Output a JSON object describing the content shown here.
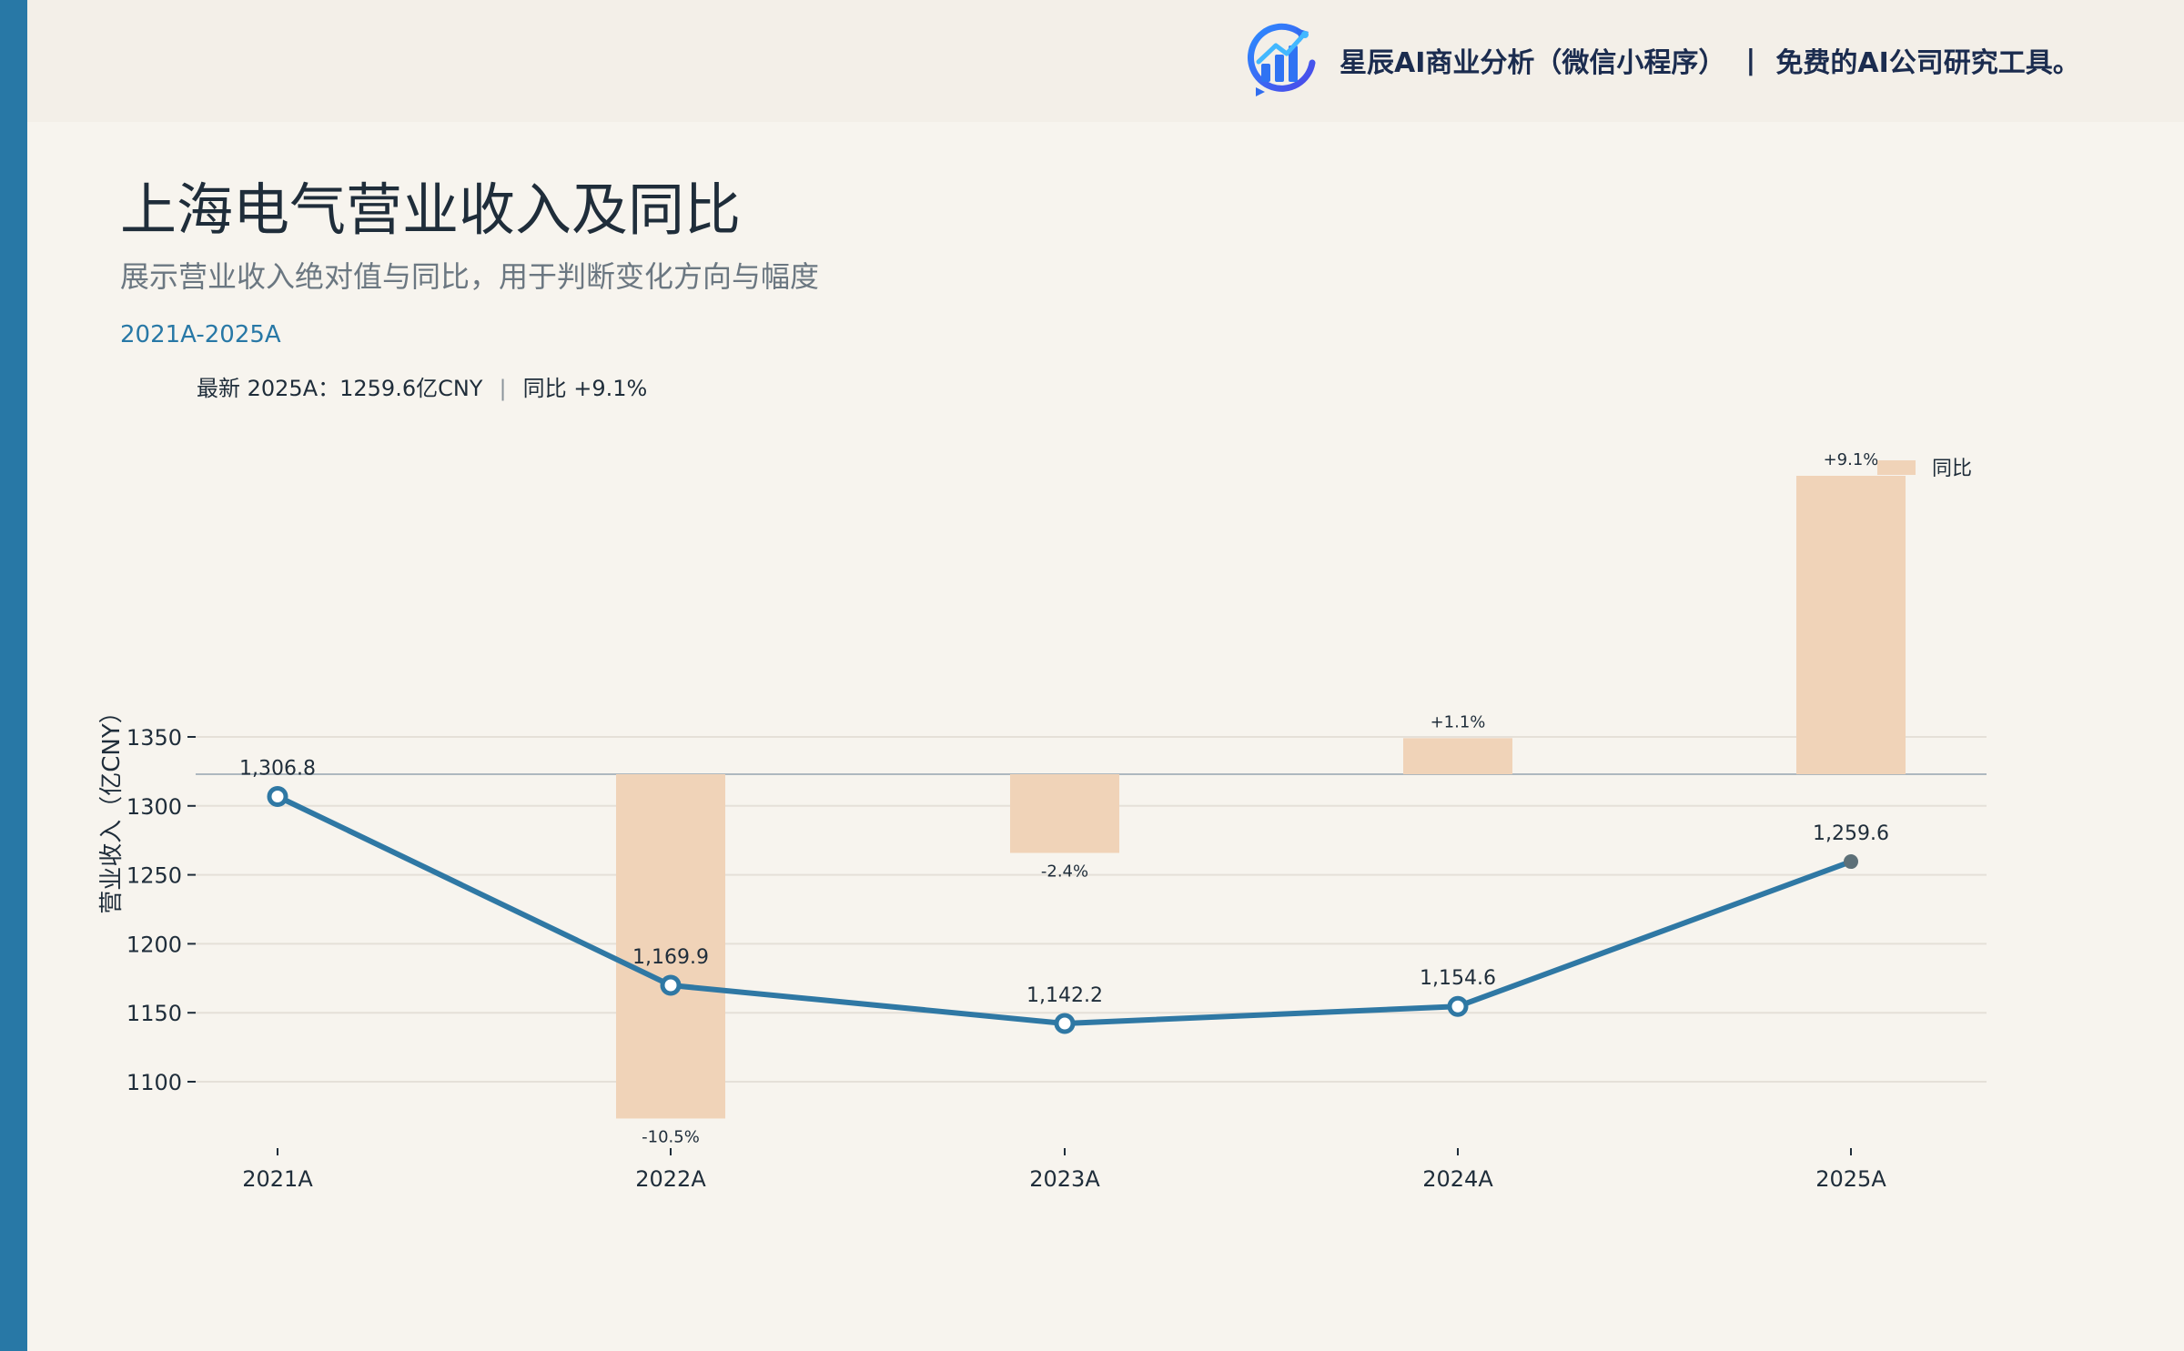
{
  "header": {
    "brand_name": "星辰AI商业分析（微信小程序）",
    "separator": "|",
    "tagline": "免费的AI公司研究工具。",
    "logo_icon": "chart-bars-cycle-icon"
  },
  "page": {
    "title": "上海电气营业收入及同比",
    "subtitle": "展示营业收入绝对值与同比，用于判断变化方向与幅度",
    "range": "2021A-2025A"
  },
  "latest_summary": {
    "value_text": "最新 2025A：1259.6亿CNY",
    "separator": "|",
    "yoy_text": "同比 +9.1%"
  },
  "colors": {
    "accent": "#2878a6",
    "line": "#2f78a4",
    "bar": "#f0d3b8",
    "top_band": "#f3efe8",
    "background": "#f7f4ee"
  },
  "chart_data": {
    "type": "bar+line",
    "categories": [
      "2021A",
      "2022A",
      "2023A",
      "2024A",
      "2025A"
    ],
    "series": [
      {
        "type": "line",
        "values": [
          1306.8,
          1169.9,
          1142.2,
          1154.6,
          1259.6
        ],
        "labels": [
          "1,306.8",
          "1,169.9",
          "1,142.2",
          "1,154.6",
          "1,259.6"
        ]
      },
      {
        "name": "同比",
        "type": "bar",
        "values": [
          null,
          -10.5,
          -2.4,
          1.1,
          9.1
        ],
        "labels": [
          "",
          "-10.5%",
          "-2.4%",
          "+1.1%",
          "+9.1%"
        ]
      }
    ],
    "ylabel": "营业收入（亿CNY）",
    "ylim": [
      1075,
      1380
    ],
    "yticks": [
      1100,
      1150,
      1200,
      1250,
      1300,
      1350
    ],
    "grid": true,
    "legend": "top-right"
  }
}
